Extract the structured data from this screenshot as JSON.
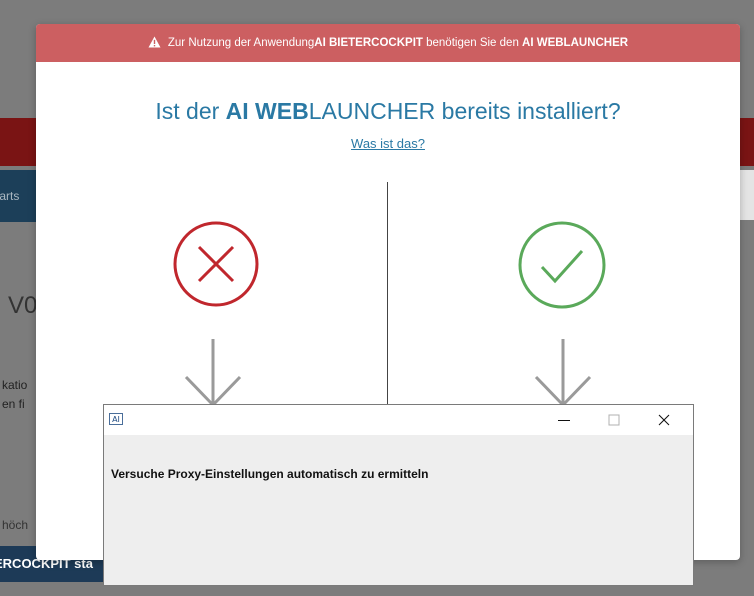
{
  "background": {
    "tab_partial": "tarts",
    "heading_partial": "V0",
    "text_line1": "katio",
    "text_line2": "en fi",
    "text_line3": "höch",
    "bottom_button_partial": "ERCOCKPIT sta"
  },
  "modal": {
    "header": {
      "prefix": "Zur Nutzung der Anwendung ",
      "app_name": "AI BIETERCOCKPIT",
      "middle": " benötigen Sie den ",
      "launcher_name": "AI WEBLAUNCHER",
      "icon": "warning-triangle-icon",
      "color": "#cc5f61"
    },
    "title": {
      "prefix": "Ist der ",
      "bold": "AI WEB",
      "rest": "LAUNCHER bereits installiert?",
      "color": "#2a79a4"
    },
    "what_link": "Was ist das?",
    "no_option": {
      "icon": "x-circle-icon",
      "color": "#c0272d"
    },
    "yes_option": {
      "icon": "check-circle-icon",
      "color": "#5aa95a"
    }
  },
  "dialog": {
    "app_icon_text": "AI",
    "message": "Versuche Proxy-Einstellungen automatisch zu ermitteln",
    "minimize_icon": "minimize-icon",
    "maximize_icon": "maximize-icon",
    "close_icon": "close-icon"
  }
}
